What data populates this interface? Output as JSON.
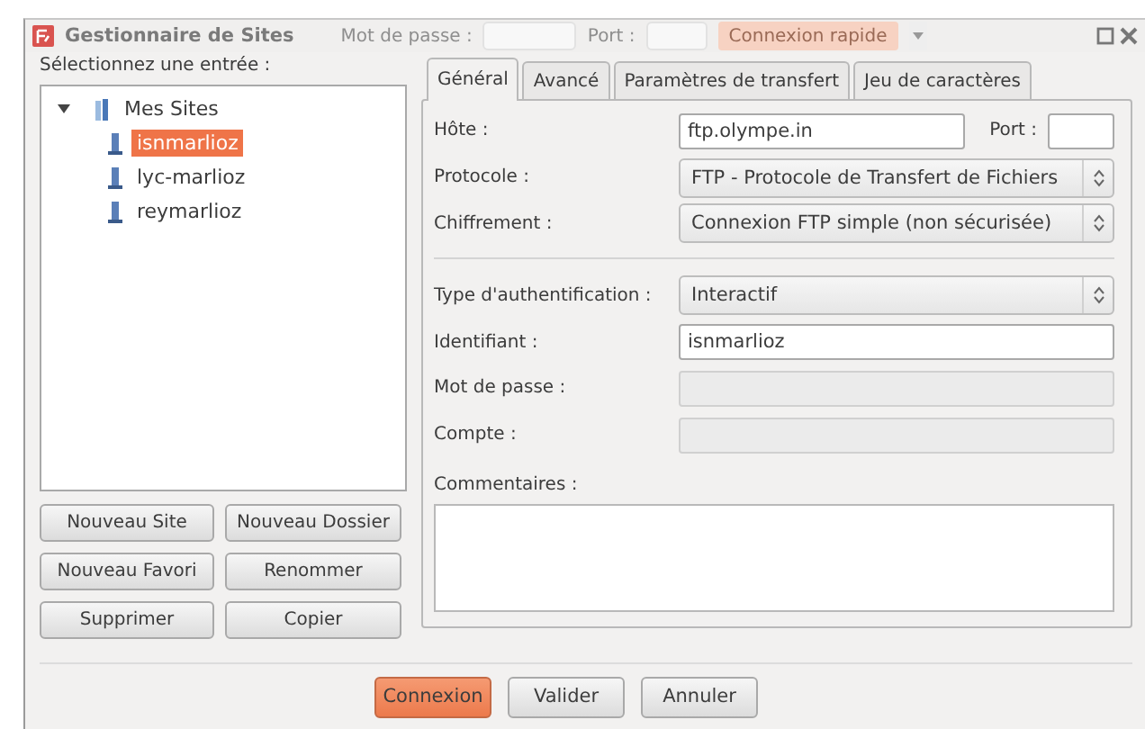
{
  "window": {
    "title": "Gestionnaire de Sites"
  },
  "background_toolbar": {
    "fields": [
      {
        "label": "Mot de passe :"
      },
      {
        "label": "Port :"
      }
    ],
    "button": "Connexion rapide"
  },
  "site_tree": {
    "label": "Sélectionnez une entrée :",
    "root": {
      "label": "Mes Sites",
      "expanded": true,
      "children": [
        {
          "label": "isnmarlioz",
          "selected": true
        },
        {
          "label": "lyc-marlioz",
          "selected": false
        },
        {
          "label": "reymarlioz",
          "selected": false
        }
      ]
    }
  },
  "site_buttons": [
    "Nouveau Site",
    "Nouveau Dossier",
    "Nouveau Favori",
    "Renommer",
    "Supprimer",
    "Copier"
  ],
  "tabs": [
    {
      "label": "Général",
      "selected": true
    },
    {
      "label": "Avancé",
      "selected": false
    },
    {
      "label": "Paramètres de transfert",
      "selected": false
    },
    {
      "label": "Jeu de caractères",
      "selected": false
    }
  ],
  "general": {
    "host": {
      "label": "Hôte :",
      "value": "ftp.olympe.in",
      "port_label": "Port :"
    },
    "sections": [
      [
        {
          "label": "Protocole :",
          "kind": "select",
          "value": "FTP - Protocole de Transfert de Fichiers"
        },
        {
          "label": "Chiffrement :",
          "kind": "select",
          "value": "Connexion FTP simple (non sécurisée)"
        }
      ],
      [
        {
          "label": "Type d'authentification :",
          "kind": "select",
          "value": "Interactif"
        },
        {
          "label": "Identifiant :",
          "kind": "input",
          "value": "isnmarlioz",
          "disabled": false
        },
        {
          "label": "Mot de passe :",
          "kind": "input",
          "disabled": true
        },
        {
          "label": "Compte :",
          "kind": "input",
          "disabled": true
        }
      ]
    ],
    "comments": {
      "label": "Commentaires :"
    }
  },
  "buttons": [
    {
      "label": "Connexion",
      "kind": "primary"
    },
    {
      "label": "Valider",
      "kind": "normal"
    },
    {
      "label": "Annuler",
      "kind": "normal"
    }
  ]
}
